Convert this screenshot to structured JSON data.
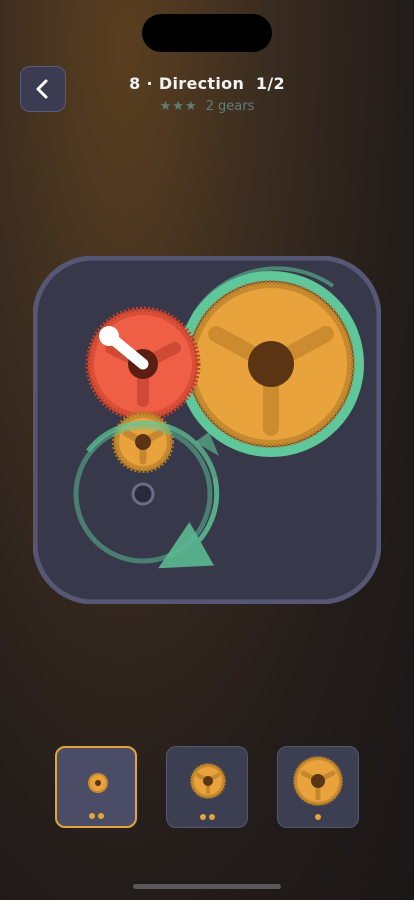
{
  "header": {
    "level_number": "8",
    "separator": "·",
    "level_name": "Direction",
    "progress": "1/2",
    "stars": "★★★",
    "gear_count_label": "2 gears"
  },
  "icons": {
    "back": "chevron-left-icon"
  },
  "colors": {
    "accent_gold": "#e3a537",
    "gear_gold": "#e8a33d",
    "gear_red": "#ef5f45",
    "ring_green": "#5fc79a",
    "board": "#373849"
  },
  "tray": {
    "slots": [
      {
        "gear_size": "small",
        "dots": 2,
        "selected": true
      },
      {
        "gear_size": "medium",
        "dots": 2,
        "selected": false
      },
      {
        "gear_size": "large",
        "dots": 1,
        "selected": false
      }
    ]
  }
}
